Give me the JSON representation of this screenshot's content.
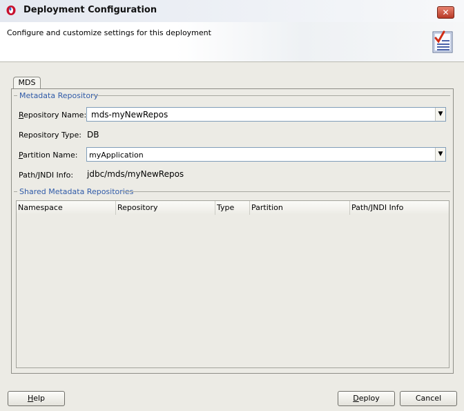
{
  "window": {
    "title": "Deployment Configuration",
    "close_label": "✕"
  },
  "header": {
    "description": "Configure and customize settings for this deployment"
  },
  "tabs": [
    {
      "label": "MDS",
      "selected": true
    }
  ],
  "metadata_repository": {
    "group_title": "Metadata Repository",
    "repository_name": {
      "label_accel": "R",
      "label_rest": "epository Name:",
      "value": "mds-myNewRepos"
    },
    "repository_type": {
      "label": "Repository Type:",
      "value": "DB"
    },
    "partition_name": {
      "label_accel": "P",
      "label_rest": "artition Name:",
      "value": "myApplication"
    },
    "path_jndi": {
      "label": "Path/JNDI Info:",
      "value": "jdbc/mds/myNewRepos"
    }
  },
  "shared_repositories": {
    "group_title": "Shared Metadata Repositories",
    "columns": [
      "Namespace",
      "Repository",
      "Type",
      "Partition",
      "Path/JNDI Info"
    ],
    "rows": []
  },
  "buttons": {
    "help": {
      "accel": "H",
      "rest": "elp"
    },
    "deploy": {
      "accel": "D",
      "rest": "eploy"
    },
    "cancel": {
      "label": "Cancel"
    }
  },
  "colors": {
    "group_title": "#2f5aa8",
    "close_button": "#b83a27"
  },
  "icons": {
    "app": "oracle-logo-icon",
    "header": "checklist-icon",
    "dropdown": "chevron-down-icon"
  }
}
